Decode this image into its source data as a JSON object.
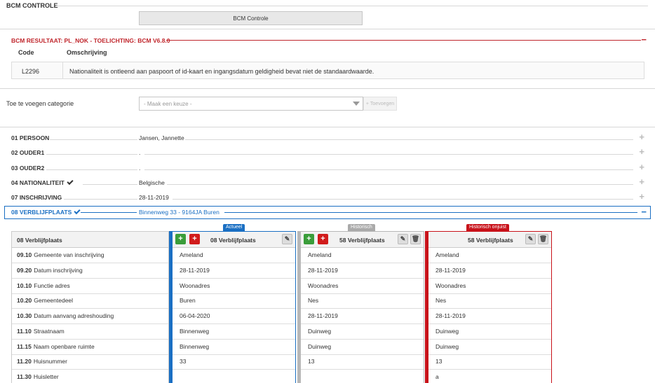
{
  "bcm": {
    "section_title": "BCM CONTROLE",
    "button_label": "BCM Controle"
  },
  "result": {
    "title": "BCM RESULTAAT: PL_NOK - TOELICHTING: BCM V6.8.0",
    "col_code": "Code",
    "col_desc": "Omschrijving",
    "rows": [
      {
        "code": "L2296",
        "desc": "Nationaliteit is ontleend aan paspoort of id-kaart en ingangsdatum geldigheid bevat niet de standaardwaarde."
      }
    ]
  },
  "add_category": {
    "label": "Toe te voegen categorie",
    "placeholder": "- Maak een keuze -",
    "button_label": "Toevoegen"
  },
  "categories": [
    {
      "label": "01 PERSOON",
      "value": "Jansen, Jannette",
      "check": false
    },
    {
      "label": "02 OUDER1",
      "value": ".",
      "check": false
    },
    {
      "label": "03 OUDER2",
      "value": ".",
      "check": false
    },
    {
      "label": "04 NATIONALITEIT",
      "value": "Belgische",
      "check": true
    },
    {
      "label": "07 INSCHRIJVING",
      "value": "28-11-2019",
      "check": false
    }
  ],
  "selected_category": {
    "label": "08 VERBLIJFPLAATS",
    "value": "Binnenweg 33 - 9164JA Buren"
  },
  "detail": {
    "labels_header": "08 Verblijfplaats",
    "labels": [
      {
        "code": "09.10",
        "text": "Gemeente van inschrijving"
      },
      {
        "code": "09.20",
        "text": "Datum inschrijving"
      },
      {
        "code": "10.10",
        "text": "Functie adres"
      },
      {
        "code": "10.20",
        "text": "Gemeentedeel"
      },
      {
        "code": "10.30",
        "text": "Datum aanvang adreshouding"
      },
      {
        "code": "11.10",
        "text": "Straatnaam"
      },
      {
        "code": "11.15",
        "text": "Naam openbare ruimte"
      },
      {
        "code": "11.20",
        "text": "Huisnummer"
      },
      {
        "code": "11.30",
        "text": "Huisletter"
      }
    ],
    "columns": [
      {
        "badge": "Actueel",
        "title": "08 Verblijfplaats",
        "color": "#1a6fc3",
        "values": [
          "Ameland",
          "28-11-2019",
          "Woonadres",
          "Buren",
          "06-04-2020",
          "Binnenweg",
          "Binnenweg",
          "33",
          ""
        ]
      },
      {
        "badge": "Historisch",
        "title": "58 Verblijfplaats",
        "color": "#b7b7b7",
        "values": [
          "Ameland",
          "28-11-2019",
          "Woonadres",
          "Nes",
          "28-11-2019",
          "Duinweg",
          "Duinweg",
          "13",
          ""
        ]
      },
      {
        "badge": "Historisch onjuist",
        "title": "58 Verblijfplaats",
        "color": "#c8121a",
        "values": [
          "Ameland",
          "28-11-2019",
          "Woonadres",
          "Nes",
          "28-11-2019",
          "Duinweg",
          "Duinweg",
          "13",
          "a"
        ]
      }
    ]
  }
}
